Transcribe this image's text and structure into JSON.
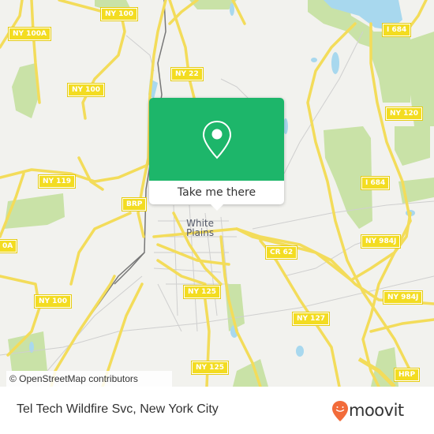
{
  "map": {
    "place_label_line1": "White",
    "place_label_line2": "Plains",
    "road_shields": [
      {
        "text": "NY 100A"
      },
      {
        "text": "NY 100"
      },
      {
        "text": "NY 22"
      },
      {
        "text": "NY 100"
      },
      {
        "text": "I 684"
      },
      {
        "text": "NY 120"
      },
      {
        "text": "NY 119"
      },
      {
        "text": "BRP"
      },
      {
        "text": "I 684"
      },
      {
        "text": "0A"
      },
      {
        "text": "CR 62"
      },
      {
        "text": "NY 984J"
      },
      {
        "text": "NY 100"
      },
      {
        "text": "NY 125"
      },
      {
        "text": "NY 984J"
      },
      {
        "text": "NY 127"
      },
      {
        "text": "NY 125"
      },
      {
        "text": "HRP"
      }
    ],
    "attribution": "© OpenStreetMap contributors",
    "colors": {
      "background": "#f2f2ee",
      "road": "#f3dc5a",
      "park": "#c9e2a7",
      "water": "#a8d8ee",
      "minor_road": "#c9c9c9"
    }
  },
  "popup": {
    "icon": "map-pin-icon",
    "button_label": "Take me there",
    "accent_color": "#1db66a"
  },
  "footer": {
    "location_title": "Tel Tech Wildfire Svc, New York City",
    "brand": "moovit",
    "brand_color": "#f26b3a"
  }
}
